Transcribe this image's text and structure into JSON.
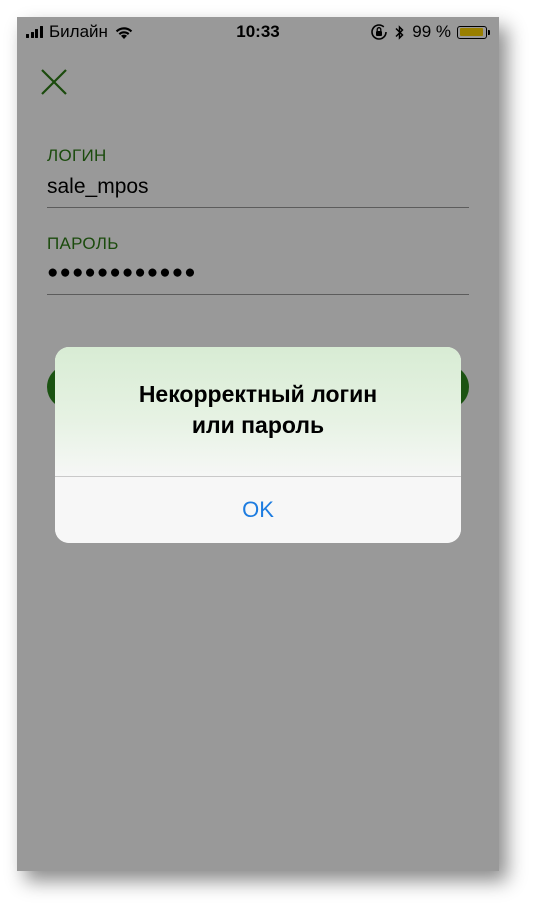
{
  "status_bar": {
    "carrier": "Билайн",
    "time": "10:33",
    "battery_percent": "99 %",
    "battery_level": 0.99,
    "battery_color": "#ffd400"
  },
  "icons": {
    "close": "close-icon",
    "signal": "signal-bars-icon",
    "wifi": "wifi-icon",
    "rotation_lock": "rotation-lock-icon",
    "bluetooth": "bluetooth-icon",
    "battery": "battery-icon"
  },
  "login_form": {
    "login_label": "ЛОГИН",
    "login_value": "sale_mpos",
    "password_label": "ПАРОЛЬ",
    "password_value": "●●●●●●●●●●●●"
  },
  "alert": {
    "title_line1": "Некорректный логин",
    "title_line2": "или пароль",
    "ok_label": "OK"
  },
  "colors": {
    "accent_green": "#2e7d16",
    "button_green": "#2e8a1e",
    "link_blue": "#1d7ce0"
  }
}
